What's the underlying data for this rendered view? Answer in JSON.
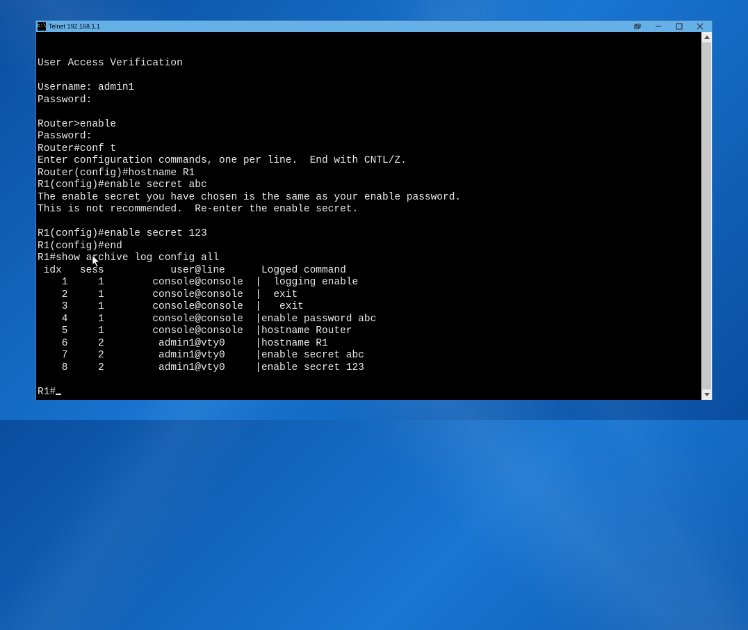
{
  "window": {
    "title": "Telnet 192.168.1.1",
    "icon_label": "C:\\"
  },
  "terminal": {
    "lines": [
      "",
      "",
      "User Access Verification",
      "",
      "Username: admin1",
      "Password:",
      "",
      "Router>enable",
      "Password:",
      "Router#conf t",
      "Enter configuration commands, one per line.  End with CNTL/Z.",
      "Router(config)#hostname R1",
      "R1(config)#enable secret abc",
      "The enable secret you have chosen is the same as your enable password.",
      "This is not recommended.  Re-enter the enable secret.",
      "",
      "R1(config)#enable secret 123",
      "R1(config)#end",
      "R1#show archive log config all",
      " idx   sess           user@line      Logged command",
      "    1     1        console@console  |  logging enable",
      "    2     1        console@console  |  exit",
      "    3     1        console@console  |   exit",
      "    4     1        console@console  |enable password abc",
      "    5     1        console@console  |hostname Router",
      "    6     2         admin1@vty0     |hostname R1",
      "    7     2         admin1@vty0     |enable secret abc",
      "    8     2         admin1@vty0     |enable secret 123",
      "",
      "R1#"
    ],
    "prompt_final": "R1#"
  },
  "archive_log": {
    "headers": [
      "idx",
      "sess",
      "user@line",
      "Logged command"
    ],
    "rows": [
      {
        "idx": 1,
        "sess": 1,
        "user_line": "console@console",
        "command": "logging enable"
      },
      {
        "idx": 2,
        "sess": 1,
        "user_line": "console@console",
        "command": "exit"
      },
      {
        "idx": 3,
        "sess": 1,
        "user_line": "console@console",
        "command": "exit"
      },
      {
        "idx": 4,
        "sess": 1,
        "user_line": "console@console",
        "command": "enable password abc"
      },
      {
        "idx": 5,
        "sess": 1,
        "user_line": "console@console",
        "command": "hostname Router"
      },
      {
        "idx": 6,
        "sess": 2,
        "user_line": "admin1@vty0",
        "command": "hostname R1"
      },
      {
        "idx": 7,
        "sess": 2,
        "user_line": "admin1@vty0",
        "command": "enable secret abc"
      },
      {
        "idx": 8,
        "sess": 2,
        "user_line": "admin1@vty0",
        "command": "enable secret 123"
      }
    ]
  }
}
